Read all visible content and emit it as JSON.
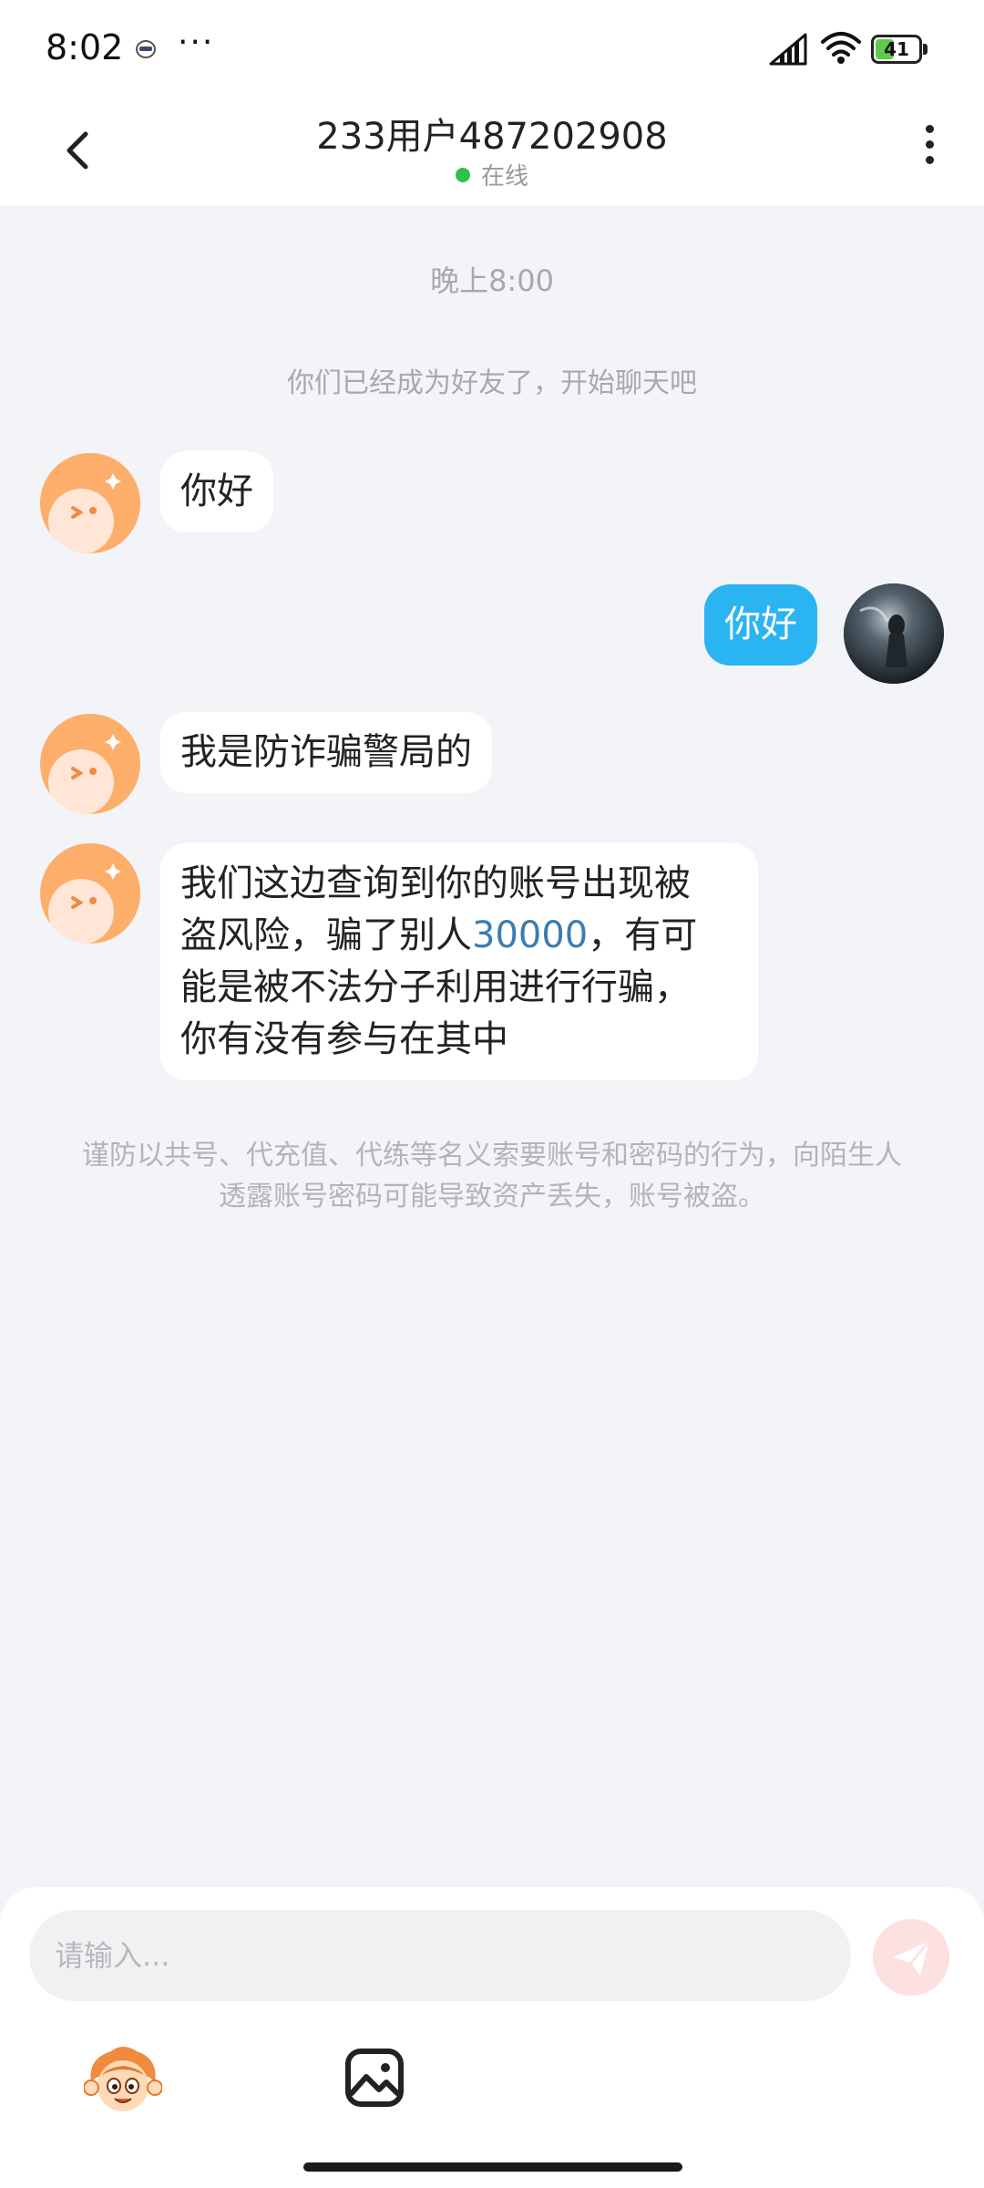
{
  "status_bar": {
    "time": "8:02",
    "dots": "···",
    "battery": "41",
    "battery_color": "#5ecb4c"
  },
  "header": {
    "title": "233用户487202908",
    "status": "在线",
    "online_color": "#2fc04e"
  },
  "chat": {
    "time_label": "晚上8:00",
    "system_notice": "你们已经成为好友了，开始聊天吧",
    "messages": [
      {
        "from": "peer",
        "text": "你好"
      },
      {
        "from": "me",
        "text": "你好"
      },
      {
        "from": "peer",
        "text": "我是防诈骗警局的"
      },
      {
        "from": "peer",
        "lines": [
          "我们这边查询到你的账号出现被",
          "盗风险，骗了别人",
          "30000",
          "，有可",
          "能是被不法分子利用进行行骗，",
          "你有没有参与在其中"
        ]
      }
    ],
    "warning": "谨防以共号、代充值、代练等名义索要账号和密码的行为，向陌生人透露账号密码可能导致资产丢失，账号被盗。"
  },
  "input": {
    "placeholder": "请输入..."
  },
  "icons": {
    "back": "back-arrow-icon",
    "more": "more-vertical-icon",
    "send": "send-icon",
    "sticker": "sticker-mascot-icon",
    "image": "image-icon"
  },
  "colors": {
    "bubble_me": "#2ab4f2",
    "highlight_number": "#3a7cb2",
    "background": "#f3f4f8"
  }
}
